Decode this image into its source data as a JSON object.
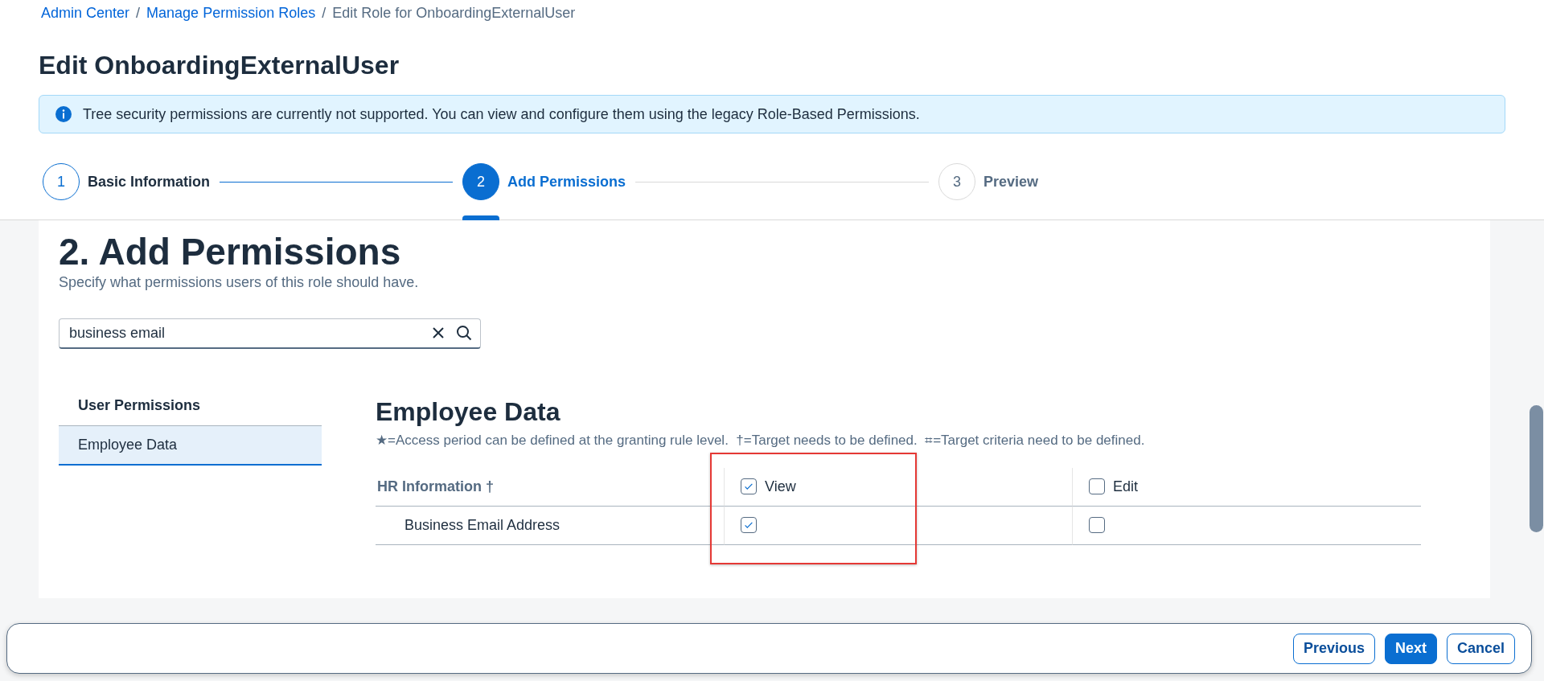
{
  "breadcrumbs": [
    {
      "label": "Admin Center",
      "link": true
    },
    {
      "label": "Manage Permission Roles",
      "link": true
    },
    {
      "label": "Edit Role for OnboardingExternalUser",
      "link": false
    }
  ],
  "separator": "/",
  "page_title": "Edit OnboardingExternalUser",
  "info_message": "Tree security permissions are currently not supported. You can view and configure them using the legacy Role-Based Permissions.",
  "steps": [
    {
      "number": "1",
      "label": "Basic Information",
      "selected": false,
      "completed": true
    },
    {
      "number": "2",
      "label": "Add Permissions",
      "selected": true,
      "completed": false
    },
    {
      "number": "3",
      "label": "Preview",
      "selected": false,
      "completed": false
    }
  ],
  "section": {
    "title": "2. Add Permissions",
    "subtitle": "Specify what permissions users of this role should have.",
    "search": {
      "value": "business email"
    }
  },
  "nav": {
    "heading": "User Permissions",
    "items": [
      {
        "label": "Employee Data",
        "selected": true
      }
    ]
  },
  "permissions": {
    "title": "Employee Data",
    "legend": "★=Access period can be defined at the granting rule level.  †=Target needs to be defined.  ⌗=Target criteria need to be defined.",
    "group": "HR Information †",
    "columns": [
      {
        "label": "View",
        "checked": true
      },
      {
        "label": "Edit",
        "checked": false
      }
    ],
    "rows": [
      {
        "label": "Business Email Address",
        "cells": [
          {
            "checked": true
          },
          {
            "checked": false
          }
        ]
      }
    ]
  },
  "footer_buttons": [
    {
      "label": "Previous",
      "kind": "secondary"
    },
    {
      "label": "Next",
      "kind": "primary"
    },
    {
      "label": "Cancel",
      "kind": "secondary"
    }
  ]
}
